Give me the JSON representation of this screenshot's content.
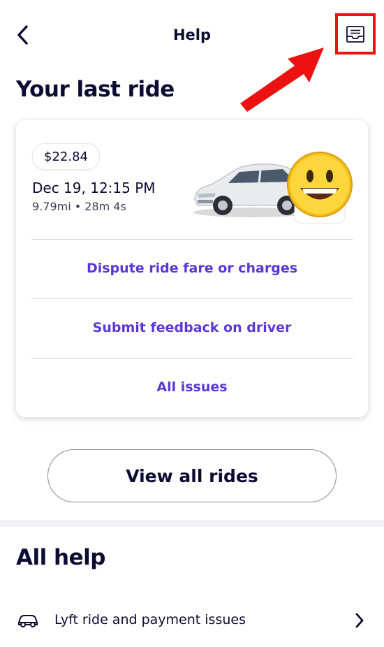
{
  "header": {
    "title": "Help",
    "back_icon": "chevron-left-icon",
    "inbox_icon": "inbox-icon"
  },
  "last_ride": {
    "section_title": "Your last ride",
    "fare": "$22.84",
    "date": "Dec 19, 12:15 PM",
    "stats": "9.79mi • 28m 4s",
    "actions": [
      "Dispute ride fare or charges",
      "Submit feedback on driver",
      "All issues"
    ],
    "view_all_label": "View all rides"
  },
  "all_help": {
    "section_title": "All help",
    "items": [
      {
        "icon": "car-icon",
        "label": "Lyft ride and payment issues"
      }
    ]
  },
  "colors": {
    "accent": "#5a37d6",
    "text": "#0c0b31",
    "annotation": "#ee1111"
  }
}
